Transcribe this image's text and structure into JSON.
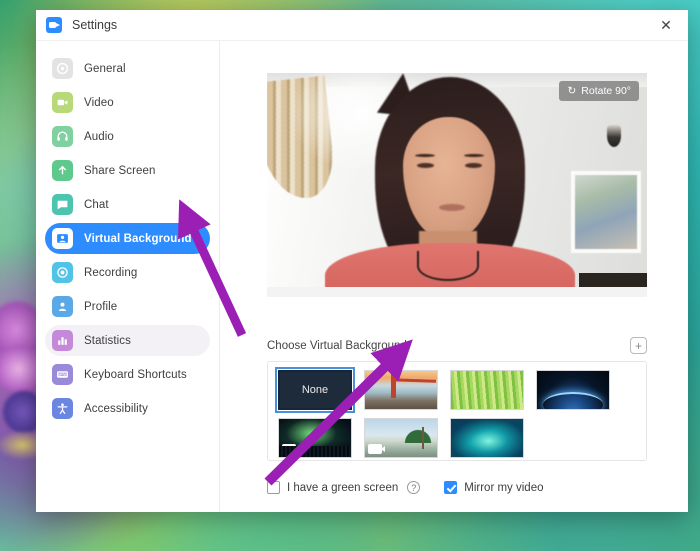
{
  "window": {
    "title": "Settings",
    "logo_icon": "zoom-logo-icon",
    "close_icon": "✕"
  },
  "sidebar": {
    "items": [
      {
        "label": "General",
        "icon": "gear-icon",
        "color": "#cfcfcf",
        "state": "normal"
      },
      {
        "label": "Video",
        "icon": "video-icon",
        "color": "#b7d97a",
        "state": "normal"
      },
      {
        "label": "Audio",
        "icon": "headset-icon",
        "color": "#7fd2a0",
        "state": "normal"
      },
      {
        "label": "Share Screen",
        "icon": "upload-icon",
        "color": "#5ec98c",
        "state": "normal"
      },
      {
        "label": "Chat",
        "icon": "chat-icon",
        "color": "#4cc4b0",
        "state": "normal"
      },
      {
        "label": "Virtual Background",
        "icon": "person-card-icon",
        "color": "#ffffff",
        "state": "active"
      },
      {
        "label": "Recording",
        "icon": "record-icon",
        "color": "#4fc3e8",
        "state": "normal"
      },
      {
        "label": "Profile",
        "icon": "person-icon",
        "color": "#5aa9e6",
        "state": "normal"
      },
      {
        "label": "Statistics",
        "icon": "bar-chart-icon",
        "color": "#c48ad9",
        "state": "hover"
      },
      {
        "label": "Keyboard Shortcuts",
        "icon": "keyboard-icon",
        "color": "#9a8ad9",
        "state": "normal"
      },
      {
        "label": "Accessibility",
        "icon": "accessibility-icon",
        "color": "#6b86e0",
        "state": "normal"
      }
    ]
  },
  "preview": {
    "rotate_label": "Rotate 90°",
    "rotate_icon": "rotate-icon"
  },
  "virtual_background": {
    "section_label": "Choose Virtual Background",
    "add_label": "+",
    "add_icon": "plus-icon",
    "thumbnails": [
      {
        "name": "None",
        "art": "none",
        "selected": true,
        "has_video_badge": false
      },
      {
        "name": "Golden Gate Bridge",
        "art": "bridge",
        "selected": false,
        "has_video_badge": false
      },
      {
        "name": "Grass",
        "art": "grass",
        "selected": false,
        "has_video_badge": false
      },
      {
        "name": "Earth from Space",
        "art": "earth",
        "selected": false,
        "has_video_badge": false
      },
      {
        "name": "Aurora Borealis",
        "art": "aurora",
        "selected": false,
        "has_video_badge": true
      },
      {
        "name": "Beach",
        "art": "beach",
        "selected": false,
        "has_video_badge": true
      },
      {
        "name": "Coral Reef",
        "art": "coral",
        "selected": false,
        "has_video_badge": false
      }
    ]
  },
  "options": {
    "green_screen": {
      "label": "I have a green screen",
      "checked": false,
      "help_icon": "?"
    },
    "mirror_video": {
      "label": "Mirror my video",
      "checked": true
    }
  },
  "colors": {
    "accent": "#2d8cff",
    "annotation_arrow": "#9b1fb5",
    "selected_outline": "#4a90d9"
  }
}
